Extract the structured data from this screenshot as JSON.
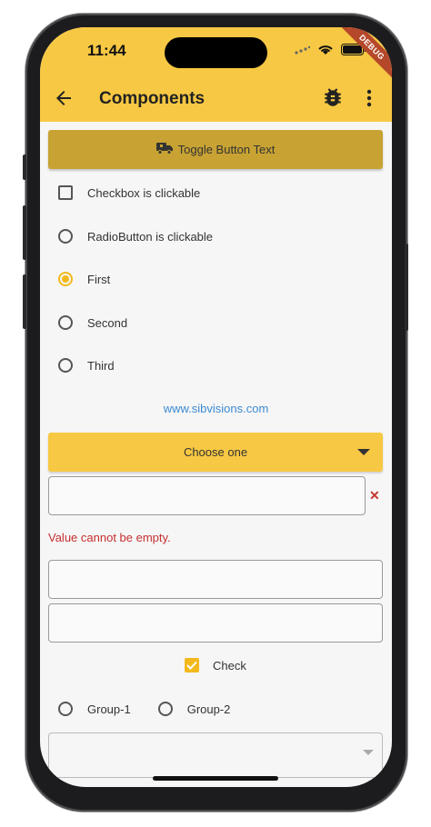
{
  "status_bar": {
    "time": "11:44",
    "debug_label": "DEBUG"
  },
  "app_bar": {
    "title": "Components",
    "back_icon": "arrow-back-icon",
    "bug_icon": "bug-icon",
    "more_icon": "more-vert-icon"
  },
  "toggle_button": {
    "label": "Toggle Button Text",
    "icon": "truck-icon"
  },
  "checkbox": {
    "label": "Checkbox is clickable",
    "checked": false
  },
  "radio_button": {
    "label": "RadioButton is clickable",
    "selected": false
  },
  "radio_group": [
    {
      "label": "First",
      "selected": true
    },
    {
      "label": "Second",
      "selected": false
    },
    {
      "label": "Third",
      "selected": false
    }
  ],
  "link": {
    "text": "www.sibvisions.com"
  },
  "dropdown": {
    "label": "Choose one"
  },
  "text_field_1": {
    "value": "",
    "error": "Value cannot be empty."
  },
  "text_field_2": {
    "value": ""
  },
  "text_field_3": {
    "value": ""
  },
  "check_item": {
    "label": "Check",
    "checked": true
  },
  "group_radios": [
    {
      "label": "Group-1",
      "selected": false
    },
    {
      "label": "Group-2",
      "selected": false
    }
  ],
  "colors": {
    "accent": "#f7c843",
    "toggle_bg": "#c8a233",
    "link": "#3c8ad4",
    "error": "#c62f2f"
  }
}
